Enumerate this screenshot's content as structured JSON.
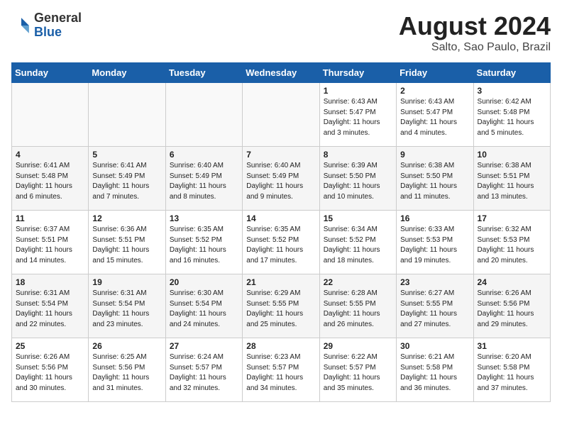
{
  "header": {
    "logo_general": "General",
    "logo_blue": "Blue",
    "month_year": "August 2024",
    "location": "Salto, Sao Paulo, Brazil"
  },
  "days_of_week": [
    "Sunday",
    "Monday",
    "Tuesday",
    "Wednesday",
    "Thursday",
    "Friday",
    "Saturday"
  ],
  "weeks": [
    [
      {
        "day": "",
        "info": ""
      },
      {
        "day": "",
        "info": ""
      },
      {
        "day": "",
        "info": ""
      },
      {
        "day": "",
        "info": ""
      },
      {
        "day": "1",
        "info": "Sunrise: 6:43 AM\nSunset: 5:47 PM\nDaylight: 11 hours\nand 3 minutes."
      },
      {
        "day": "2",
        "info": "Sunrise: 6:43 AM\nSunset: 5:47 PM\nDaylight: 11 hours\nand 4 minutes."
      },
      {
        "day": "3",
        "info": "Sunrise: 6:42 AM\nSunset: 5:48 PM\nDaylight: 11 hours\nand 5 minutes."
      }
    ],
    [
      {
        "day": "4",
        "info": "Sunrise: 6:41 AM\nSunset: 5:48 PM\nDaylight: 11 hours\nand 6 minutes."
      },
      {
        "day": "5",
        "info": "Sunrise: 6:41 AM\nSunset: 5:49 PM\nDaylight: 11 hours\nand 7 minutes."
      },
      {
        "day": "6",
        "info": "Sunrise: 6:40 AM\nSunset: 5:49 PM\nDaylight: 11 hours\nand 8 minutes."
      },
      {
        "day": "7",
        "info": "Sunrise: 6:40 AM\nSunset: 5:49 PM\nDaylight: 11 hours\nand 9 minutes."
      },
      {
        "day": "8",
        "info": "Sunrise: 6:39 AM\nSunset: 5:50 PM\nDaylight: 11 hours\nand 10 minutes."
      },
      {
        "day": "9",
        "info": "Sunrise: 6:38 AM\nSunset: 5:50 PM\nDaylight: 11 hours\nand 11 minutes."
      },
      {
        "day": "10",
        "info": "Sunrise: 6:38 AM\nSunset: 5:51 PM\nDaylight: 11 hours\nand 13 minutes."
      }
    ],
    [
      {
        "day": "11",
        "info": "Sunrise: 6:37 AM\nSunset: 5:51 PM\nDaylight: 11 hours\nand 14 minutes."
      },
      {
        "day": "12",
        "info": "Sunrise: 6:36 AM\nSunset: 5:51 PM\nDaylight: 11 hours\nand 15 minutes."
      },
      {
        "day": "13",
        "info": "Sunrise: 6:35 AM\nSunset: 5:52 PM\nDaylight: 11 hours\nand 16 minutes."
      },
      {
        "day": "14",
        "info": "Sunrise: 6:35 AM\nSunset: 5:52 PM\nDaylight: 11 hours\nand 17 minutes."
      },
      {
        "day": "15",
        "info": "Sunrise: 6:34 AM\nSunset: 5:52 PM\nDaylight: 11 hours\nand 18 minutes."
      },
      {
        "day": "16",
        "info": "Sunrise: 6:33 AM\nSunset: 5:53 PM\nDaylight: 11 hours\nand 19 minutes."
      },
      {
        "day": "17",
        "info": "Sunrise: 6:32 AM\nSunset: 5:53 PM\nDaylight: 11 hours\nand 20 minutes."
      }
    ],
    [
      {
        "day": "18",
        "info": "Sunrise: 6:31 AM\nSunset: 5:54 PM\nDaylight: 11 hours\nand 22 minutes."
      },
      {
        "day": "19",
        "info": "Sunrise: 6:31 AM\nSunset: 5:54 PM\nDaylight: 11 hours\nand 23 minutes."
      },
      {
        "day": "20",
        "info": "Sunrise: 6:30 AM\nSunset: 5:54 PM\nDaylight: 11 hours\nand 24 minutes."
      },
      {
        "day": "21",
        "info": "Sunrise: 6:29 AM\nSunset: 5:55 PM\nDaylight: 11 hours\nand 25 minutes."
      },
      {
        "day": "22",
        "info": "Sunrise: 6:28 AM\nSunset: 5:55 PM\nDaylight: 11 hours\nand 26 minutes."
      },
      {
        "day": "23",
        "info": "Sunrise: 6:27 AM\nSunset: 5:55 PM\nDaylight: 11 hours\nand 27 minutes."
      },
      {
        "day": "24",
        "info": "Sunrise: 6:26 AM\nSunset: 5:56 PM\nDaylight: 11 hours\nand 29 minutes."
      }
    ],
    [
      {
        "day": "25",
        "info": "Sunrise: 6:26 AM\nSunset: 5:56 PM\nDaylight: 11 hours\nand 30 minutes."
      },
      {
        "day": "26",
        "info": "Sunrise: 6:25 AM\nSunset: 5:56 PM\nDaylight: 11 hours\nand 31 minutes."
      },
      {
        "day": "27",
        "info": "Sunrise: 6:24 AM\nSunset: 5:57 PM\nDaylight: 11 hours\nand 32 minutes."
      },
      {
        "day": "28",
        "info": "Sunrise: 6:23 AM\nSunset: 5:57 PM\nDaylight: 11 hours\nand 34 minutes."
      },
      {
        "day": "29",
        "info": "Sunrise: 6:22 AM\nSunset: 5:57 PM\nDaylight: 11 hours\nand 35 minutes."
      },
      {
        "day": "30",
        "info": "Sunrise: 6:21 AM\nSunset: 5:58 PM\nDaylight: 11 hours\nand 36 minutes."
      },
      {
        "day": "31",
        "info": "Sunrise: 6:20 AM\nSunset: 5:58 PM\nDaylight: 11 hours\nand 37 minutes."
      }
    ]
  ]
}
